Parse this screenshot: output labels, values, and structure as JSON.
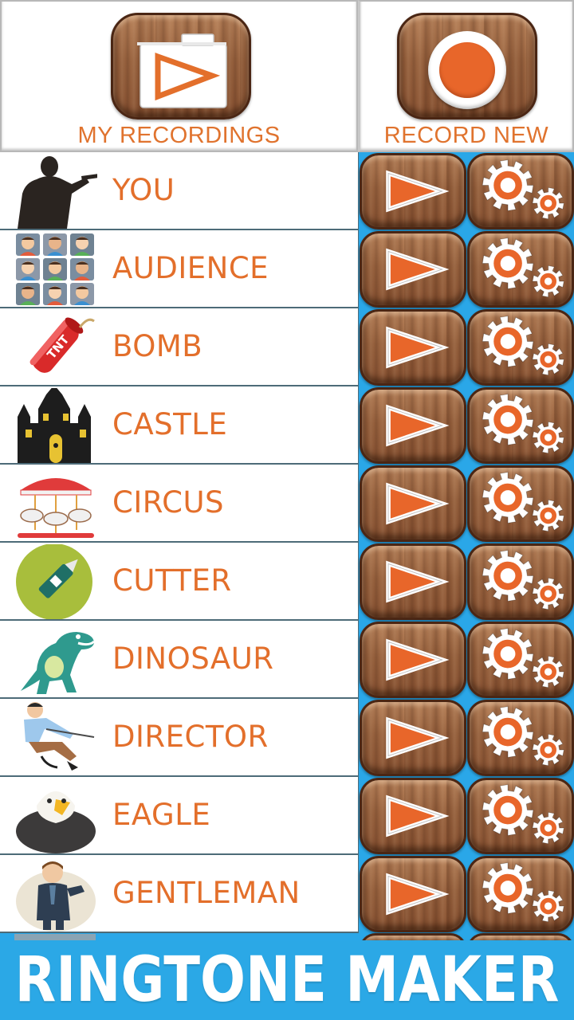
{
  "header": {
    "my_recordings_label": "MY RECORDINGS",
    "record_new_label": "RECORD NEW"
  },
  "colors": {
    "accent_orange": "#e36f2b",
    "footer_blue": "#2ba8e6",
    "wood": "#9a6440"
  },
  "sounds": [
    {
      "label": "YOU",
      "icon": "singer-silhouette-icon"
    },
    {
      "label": "AUDIENCE",
      "icon": "audience-faces-icon"
    },
    {
      "label": "BOMB",
      "icon": "tnt-dynamite-icon"
    },
    {
      "label": "CASTLE",
      "icon": "haunted-castle-icon"
    },
    {
      "label": "CIRCUS",
      "icon": "carousel-icon"
    },
    {
      "label": "CUTTER",
      "icon": "box-cutter-icon"
    },
    {
      "label": "DINOSAUR",
      "icon": "dinosaur-icon"
    },
    {
      "label": "DIRECTOR",
      "icon": "director-icon"
    },
    {
      "label": "EAGLE",
      "icon": "eagle-icon"
    },
    {
      "label": "GENTLEMAN",
      "icon": "gentleman-icon"
    }
  ],
  "row_actions": {
    "play_icon": "play-triangle-icon",
    "settings_icon": "gears-icon"
  },
  "footer": {
    "title": "RINGTONE MAKER"
  }
}
